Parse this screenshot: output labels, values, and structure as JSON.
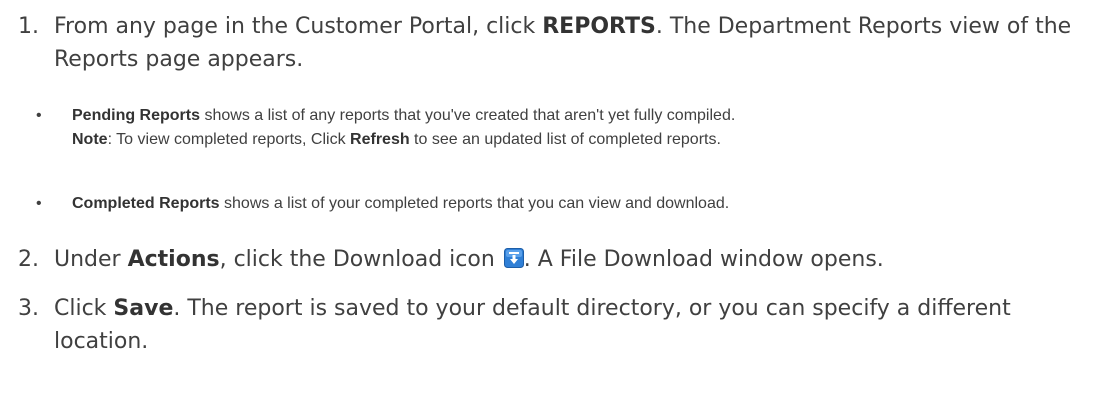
{
  "steps": [
    {
      "number": "1.",
      "segments": [
        {
          "text": "From any page in the Customer Portal, click ",
          "bold": false
        },
        {
          "text": "REPORTS",
          "bold": true
        },
        {
          "text": ". The Department Reports view of the Reports page appears.",
          "bold": false
        }
      ]
    },
    {
      "number": "2.",
      "segments": [
        {
          "text": "Under ",
          "bold": false
        },
        {
          "text": "Actions",
          "bold": true
        },
        {
          "text": ", click the Download icon ",
          "bold": false
        },
        {
          "icon": "download-icon"
        },
        {
          "text": ". A File Download window opens.",
          "bold": false
        }
      ]
    },
    {
      "number": "3.",
      "segments": [
        {
          "text": "Click ",
          "bold": false
        },
        {
          "text": "Save",
          "bold": true
        },
        {
          "text": ". The report is saved to your default directory, or you can specify a different location.",
          "bold": false
        }
      ]
    }
  ],
  "bullets": [
    {
      "marker": "•",
      "segments": [
        {
          "text": "Pending Reports",
          "bold": true
        },
        {
          "text": " shows a list of any reports that you've created that aren't yet fully compiled.",
          "bold": false
        }
      ],
      "note": [
        {
          "text": "Note",
          "bold": true
        },
        {
          "text": ": To view completed reports, Click ",
          "bold": false
        },
        {
          "text": "Refresh",
          "bold": true
        },
        {
          "text": " to see an updated list of completed reports.",
          "bold": false
        }
      ]
    },
    {
      "marker": "•",
      "segments": [
        {
          "text": "Completed Reports",
          "bold": true
        },
        {
          "text": " shows a list of your completed reports that you can view and download.",
          "bold": false
        }
      ]
    }
  ],
  "icon_colors": {
    "download_bg": "#2f7fd6",
    "download_arrow": "#ffffff"
  }
}
